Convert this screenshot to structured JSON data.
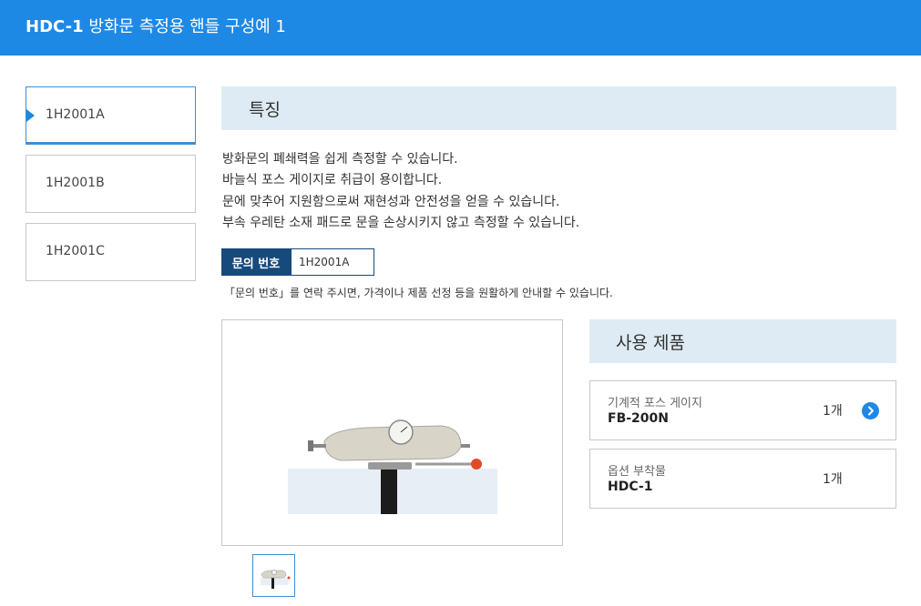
{
  "header": {
    "model": "HDC-1",
    "title": "방화문 측정용 핸들 구성예 1"
  },
  "tabs": [
    {
      "label": "1H2001A",
      "active": true
    },
    {
      "label": "1H2001B",
      "active": false
    },
    {
      "label": "1H2001C",
      "active": false
    }
  ],
  "features": {
    "title": "특징",
    "lines": [
      "방화문의 폐쇄력을 쉽게 측정할 수 있습니다.",
      "바늘식 포스 게이지로 취급이 용이합니다.",
      "문에 맞추어 지원함으로써 재현성과 안전성을 얻을 수 있습니다.",
      "부속 우레탄 소재 패드로 문을 손상시키지 않고 측정할 수 있습니다."
    ]
  },
  "inquiry": {
    "label": "문의 번호",
    "value": "1H2001A",
    "note": "「문의 번호」를 연락 주시면, 가격이나 제품 선정 등을 원활하게 안내할 수 있습니다."
  },
  "products": {
    "title": "사용 제품",
    "items": [
      {
        "category": "기계적 포스 게이지",
        "name": "FB-200N",
        "qty": "1개",
        "has_link": true
      },
      {
        "category": "옵션 부착물",
        "name": "HDC-1",
        "qty": "1개",
        "has_link": false
      }
    ]
  },
  "colors": {
    "header_bg": "#1e88e5",
    "accent": "#1e88e5",
    "section_bg": "#deebf4",
    "inquiry_label_bg": "#174a7c"
  }
}
